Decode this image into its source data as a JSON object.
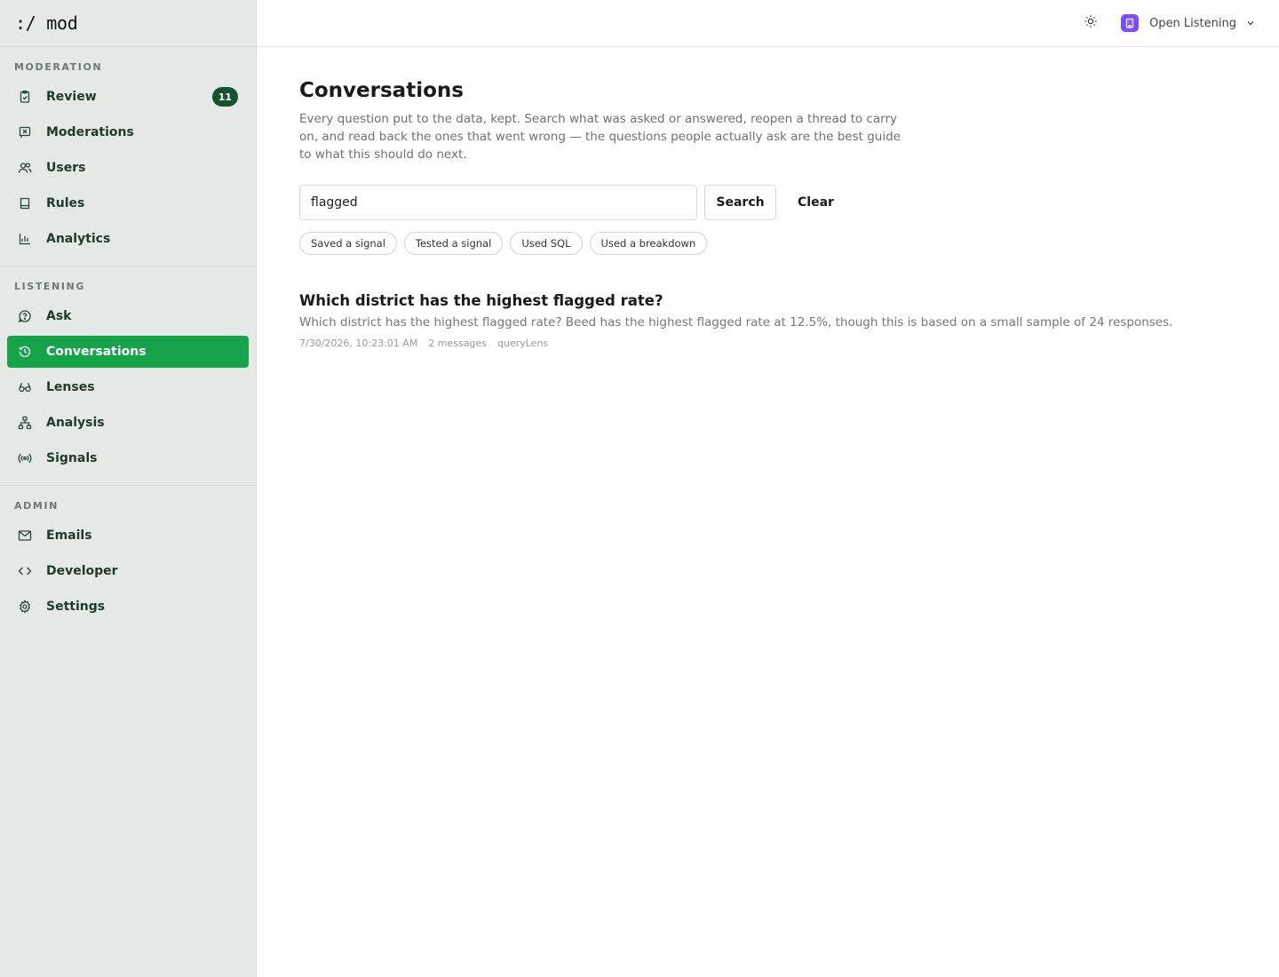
{
  "brand": ":/ mod",
  "sidebar": {
    "sections": [
      {
        "title": "MODERATION",
        "items": [
          {
            "label": "Review",
            "icon": "clipboard-icon",
            "badge": "11"
          },
          {
            "label": "Moderations",
            "icon": "flag-icon"
          },
          {
            "label": "Users",
            "icon": "users-icon"
          },
          {
            "label": "Rules",
            "icon": "book-icon"
          },
          {
            "label": "Analytics",
            "icon": "chart-icon"
          }
        ]
      },
      {
        "title": "LISTENING",
        "items": [
          {
            "label": "Ask",
            "icon": "message-question-icon"
          },
          {
            "label": "Conversations",
            "icon": "history-icon",
            "active": true
          },
          {
            "label": "Lenses",
            "icon": "glasses-icon"
          },
          {
            "label": "Analysis",
            "icon": "network-icon"
          },
          {
            "label": "Signals",
            "icon": "radio-icon"
          }
        ]
      },
      {
        "title": "ADMIN",
        "items": [
          {
            "label": "Emails",
            "icon": "mail-icon"
          },
          {
            "label": "Developer",
            "icon": "code-icon"
          },
          {
            "label": "Settings",
            "icon": "gear-icon"
          }
        ]
      }
    ]
  },
  "topbar": {
    "org_name": "Open Listening",
    "theme_icon": "sun-icon"
  },
  "main": {
    "title": "Conversations",
    "description": "Every question put to the data, kept. Search what was asked or answered, reopen a thread to carry on, and read back the ones that went wrong — the questions people actually ask are the best guide to what this should do next.",
    "search": {
      "value": "flagged",
      "placeholder": ""
    },
    "search_button": "Search",
    "clear_button": "Clear",
    "filters": [
      "Saved a signal",
      "Tested a signal",
      "Used SQL",
      "Used a breakdown"
    ],
    "conversations": [
      {
        "title": "Which district has the highest flagged rate?",
        "snippet": "Which district has the highest flagged rate? Beed has the highest flagged rate at 12.5%, though this is based on a small sample of 24 responses.",
        "timestamp": "7/30/2026, 10:23:01 AM",
        "messages": "2 messages",
        "lens": "queryLens"
      }
    ]
  }
}
